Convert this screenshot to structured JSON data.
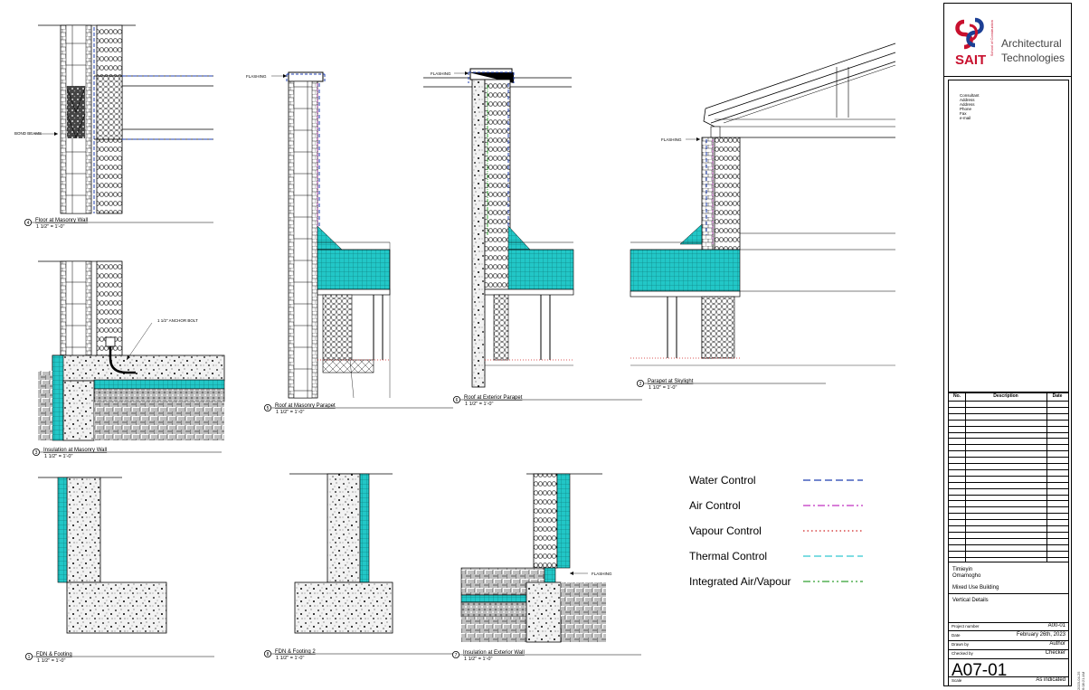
{
  "colors": {
    "water": "#1f3fb0",
    "air": "#c030c0",
    "vapour": "#d02020",
    "thermal": "#30c8d0",
    "integrated": "#30a030",
    "insulation_fill": "#22c7c7",
    "sait_red": "#c8102e",
    "sait_blue": "#1c3f94"
  },
  "details": [
    {
      "number": "4",
      "title": "Floor at Masonry Wall",
      "scale": "1 1/2\" = 1'-0\""
    },
    {
      "number": "3",
      "title": "Insulation at Masonry Wall",
      "scale": "1 1/2\" = 1'-0\""
    },
    {
      "number": "5",
      "title": "Roof at Masonry Parapet",
      "scale": "1 1/2\" = 1'-0\""
    },
    {
      "number": "6",
      "title": "Roof at Exterior Parapet",
      "scale": "1 1/2\" = 1'-0\""
    },
    {
      "number": "2",
      "title": "Parapet at Skylight",
      "scale": "1 1/2\" = 1'-0\""
    },
    {
      "number": "1",
      "title": "FDN & Footing",
      "scale": "1 1/2\" = 1'-0\""
    },
    {
      "number": "8",
      "title": "FDN & Footing 2",
      "scale": "1 1/2\" = 1'-0\""
    },
    {
      "number": "7",
      "title": "Insulation at Exterior Wall",
      "scale": "1 1/2\" = 1'-0\""
    }
  ],
  "annotations": {
    "bond_beams": "BOND BEAMS",
    "anchor_bolt": "1 1/2\" ANCHOR BOLT",
    "flashing": "FLASHING"
  },
  "legend": [
    {
      "label": "Water Control",
      "style": "dashed",
      "color_key": "water"
    },
    {
      "label": "Air Control",
      "style": "dashdot",
      "color_key": "air"
    },
    {
      "label": "Vapour Control",
      "style": "dotted",
      "color_key": "vapour"
    },
    {
      "label": "Thermal Control",
      "style": "dashed",
      "color_key": "thermal"
    },
    {
      "label": "Integrated Air/Vapour",
      "style": "dashdotdot",
      "color_key": "integrated"
    }
  ],
  "titleblock": {
    "school": "SAIT",
    "school_sub": "School of Construction",
    "program_line1": "Architectural",
    "program_line2": "Technologies",
    "consultant": [
      "Consultant",
      "Address",
      "Address",
      "Phone",
      "Fax",
      "e-mail"
    ],
    "rev_headers": {
      "no": "No.",
      "description": "Description",
      "date": "Date"
    },
    "student_line1": "Timieyin",
    "student_line2": "Omamogho",
    "project": "Mixed Use Building",
    "sheet_title": "Vertical Details",
    "project_number_label": "Project number",
    "project_number": "A00-01",
    "date_label": "Date",
    "date": "February 26th, 2023",
    "drawn_by_label": "Drawn by",
    "drawn_by": "Author",
    "checked_by_label": "Checked by",
    "checked_by": "Checker",
    "sheet_number": "A07-01",
    "scale_label": "Scale",
    "scale": "As indicated",
    "stamp": "2023-04-25 6:08:21 AM"
  }
}
